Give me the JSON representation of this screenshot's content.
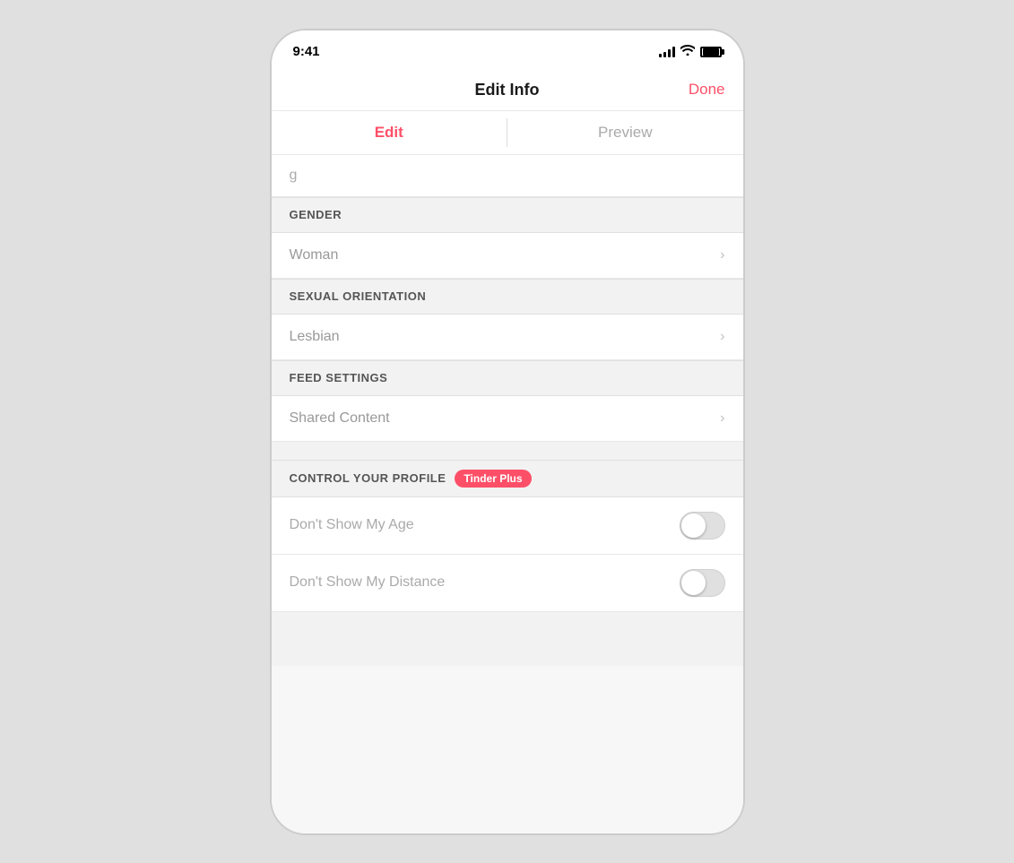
{
  "statusBar": {
    "time": "9:41",
    "signal": "signal-icon",
    "wifi": "wifi-icon",
    "battery": "battery-icon"
  },
  "navBar": {
    "title": "Edit Info",
    "doneLabel": "Done"
  },
  "tabs": [
    {
      "id": "edit",
      "label": "Edit",
      "active": true
    },
    {
      "id": "preview",
      "label": "Preview",
      "active": false
    }
  ],
  "sections": [
    {
      "id": "gender",
      "title": "GENDER",
      "rows": [
        {
          "id": "woman",
          "text": "Woman"
        }
      ]
    },
    {
      "id": "sexual-orientation",
      "title": "SEXUAL ORIENTATION",
      "rows": [
        {
          "id": "lesbian",
          "text": "Lesbian"
        }
      ]
    },
    {
      "id": "feed-settings",
      "title": "FEED SETTINGS",
      "rows": [
        {
          "id": "shared-content",
          "text": "Shared Content"
        }
      ]
    }
  ],
  "controlSection": {
    "title": "CONTROL YOUR PROFILE",
    "badge": "Tinder Plus",
    "toggles": [
      {
        "id": "dont-show-age",
        "label": "Don't Show My Age",
        "enabled": false
      },
      {
        "id": "dont-show-distance",
        "label": "Don't Show My Distance",
        "enabled": false
      }
    ]
  },
  "partialRow": {
    "text": "g"
  }
}
